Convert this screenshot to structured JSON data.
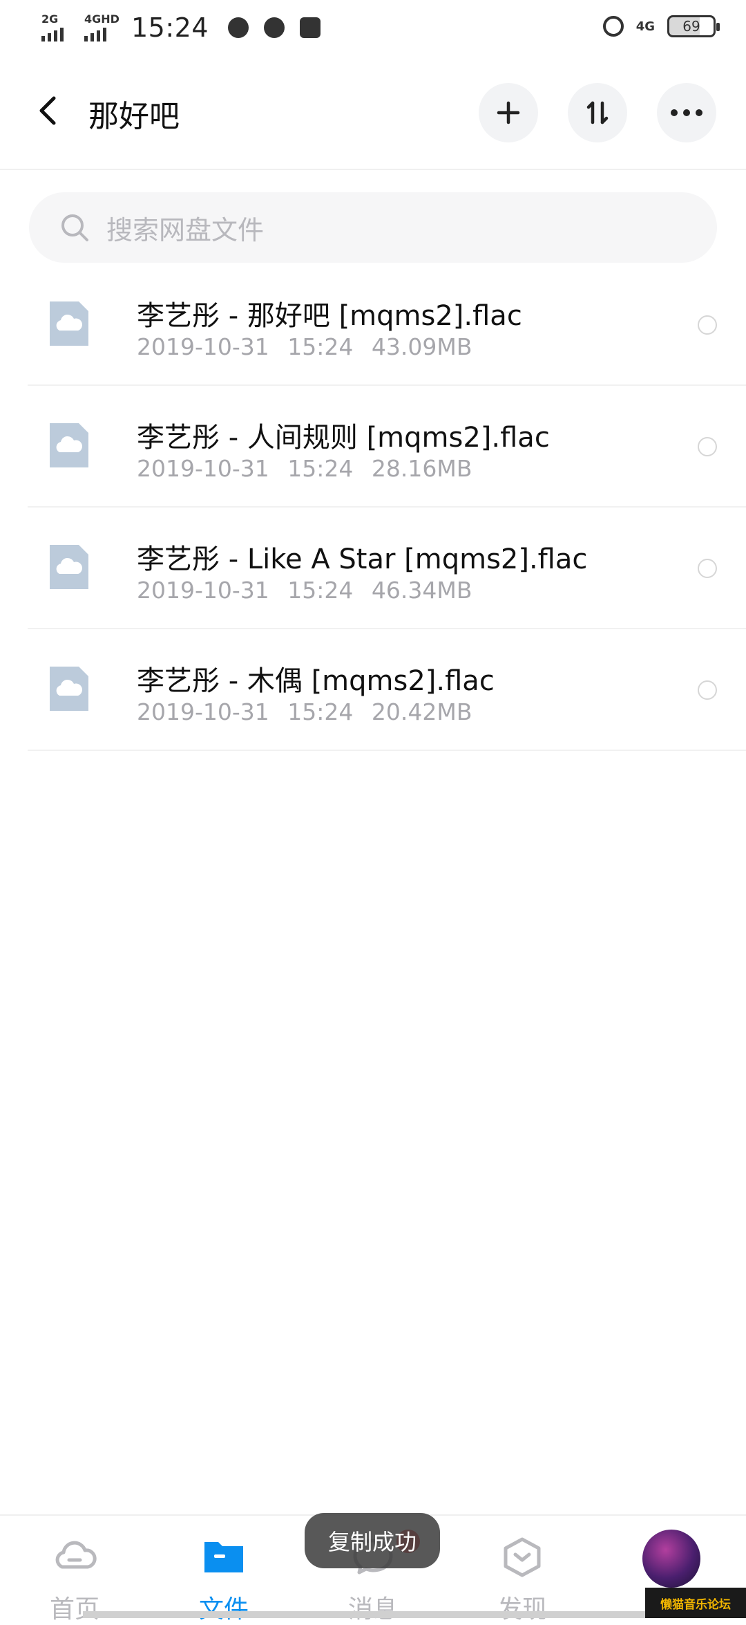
{
  "status_bar": {
    "sim1_label": "2G",
    "sim2_label": "4GHD",
    "time": "15:24",
    "net_label": "4G",
    "battery": "69"
  },
  "header": {
    "title": "那好吧",
    "back_icon": "chevron-left-icon",
    "add_icon": "plus-icon",
    "sort_icon": "sort-icon",
    "more_icon": "more-icon"
  },
  "search": {
    "placeholder": "搜索网盘文件"
  },
  "files": [
    {
      "name": "李艺彤 - 那好吧 [mqms2].flac",
      "date": "2019-10-31",
      "time": "15:24",
      "size": "43.09MB"
    },
    {
      "name": "李艺彤 - 人间规则 [mqms2].flac",
      "date": "2019-10-31",
      "time": "15:24",
      "size": "28.16MB"
    },
    {
      "name": "李艺彤 - Like A Star [mqms2].flac",
      "date": "2019-10-31",
      "time": "15:24",
      "size": "46.34MB"
    },
    {
      "name": "李艺彤 - 木偶 [mqms2].flac",
      "date": "2019-10-31",
      "time": "15:24",
      "size": "20.42MB"
    }
  ],
  "toast": "复制成功",
  "nav": {
    "home": "首页",
    "files": "文件",
    "messages": "消息",
    "discover": "发现"
  },
  "watermark": "懒猫音乐论坛",
  "colors": {
    "accent": "#0a8ff0",
    "file_icon": "#bccbdb"
  }
}
